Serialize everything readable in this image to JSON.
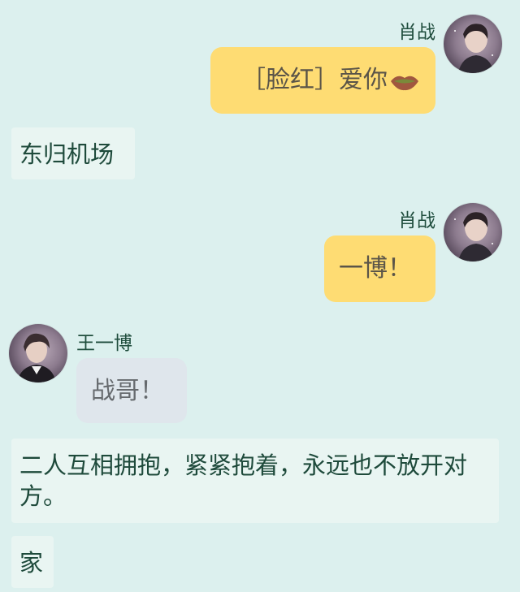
{
  "messages": [
    {
      "sender": "肖战",
      "side": "right",
      "text": "［脸红］爱你",
      "emoji": "lips-icon"
    },
    {
      "type": "narration",
      "text": "东归机场"
    },
    {
      "sender": "肖战",
      "side": "right",
      "text": "一博！"
    },
    {
      "sender": "王一博",
      "side": "left",
      "text": "战哥！"
    },
    {
      "type": "narration",
      "text": "二人互相拥抱，紧紧抱着，永远也不放开对方。"
    },
    {
      "type": "narration",
      "text": "家"
    }
  ],
  "colors": {
    "background": "#dcf0ee",
    "me_bubble": "#fedc73",
    "other_bubble": "#dfe6ec",
    "narration_box": "#e9f5f2",
    "name_text": "#1f4d3d"
  }
}
